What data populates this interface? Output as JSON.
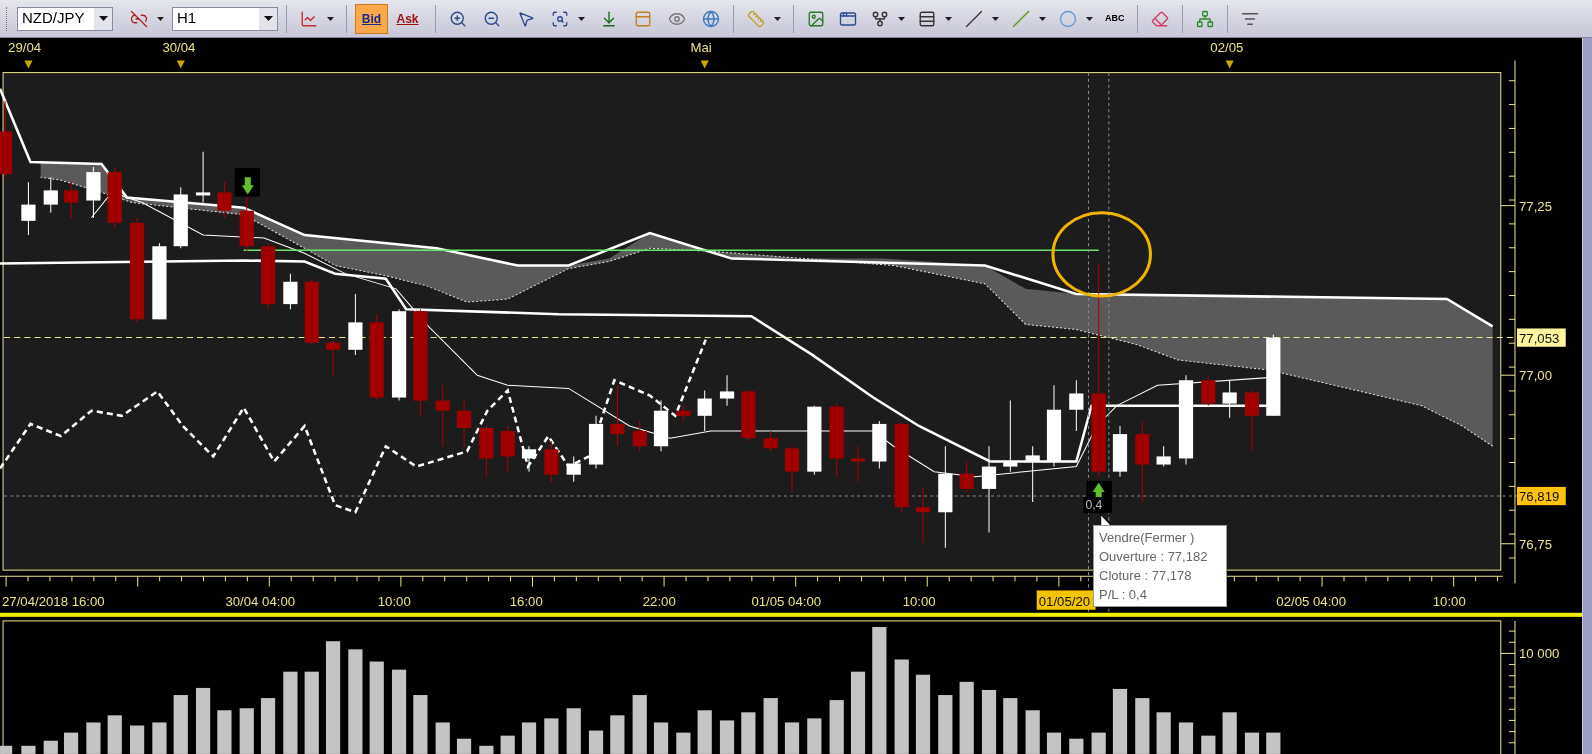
{
  "toolbar": {
    "symbol": "NZD/JPY",
    "timeframe": "H1",
    "price_buttons": [
      {
        "label": "Bid",
        "selected": true
      },
      {
        "label": "Ask",
        "selected": false
      }
    ],
    "text_tool": "ABC"
  },
  "chart": {
    "top_dates": [
      "29/04",
      "30/04",
      "Mai",
      "02/05"
    ],
    "price_ticks": [
      "77,25",
      "77,00",
      "76,75"
    ],
    "price_markers": [
      {
        "label": "77,053",
        "color": "#fff59d"
      },
      {
        "label": "76,819",
        "color": "#ffc20e"
      }
    ],
    "time_labels": [
      "27/04/2018 16:00",
      "30/04 04:00",
      "10:00",
      "16:00",
      "22:00",
      "01/05 04:00",
      "10:00",
      "02/05 04:00",
      "10:00"
    ],
    "cursor_time": "01/05/20",
    "trade_label": "0,4",
    "tooltip": {
      "lines": [
        "Vendre(Fermer )",
        "Ouverture : 77,182",
        "Cloture : 77,178",
        "P/L : 0,4"
      ]
    }
  },
  "volume": {
    "ticks": [
      "10 000"
    ]
  }
}
